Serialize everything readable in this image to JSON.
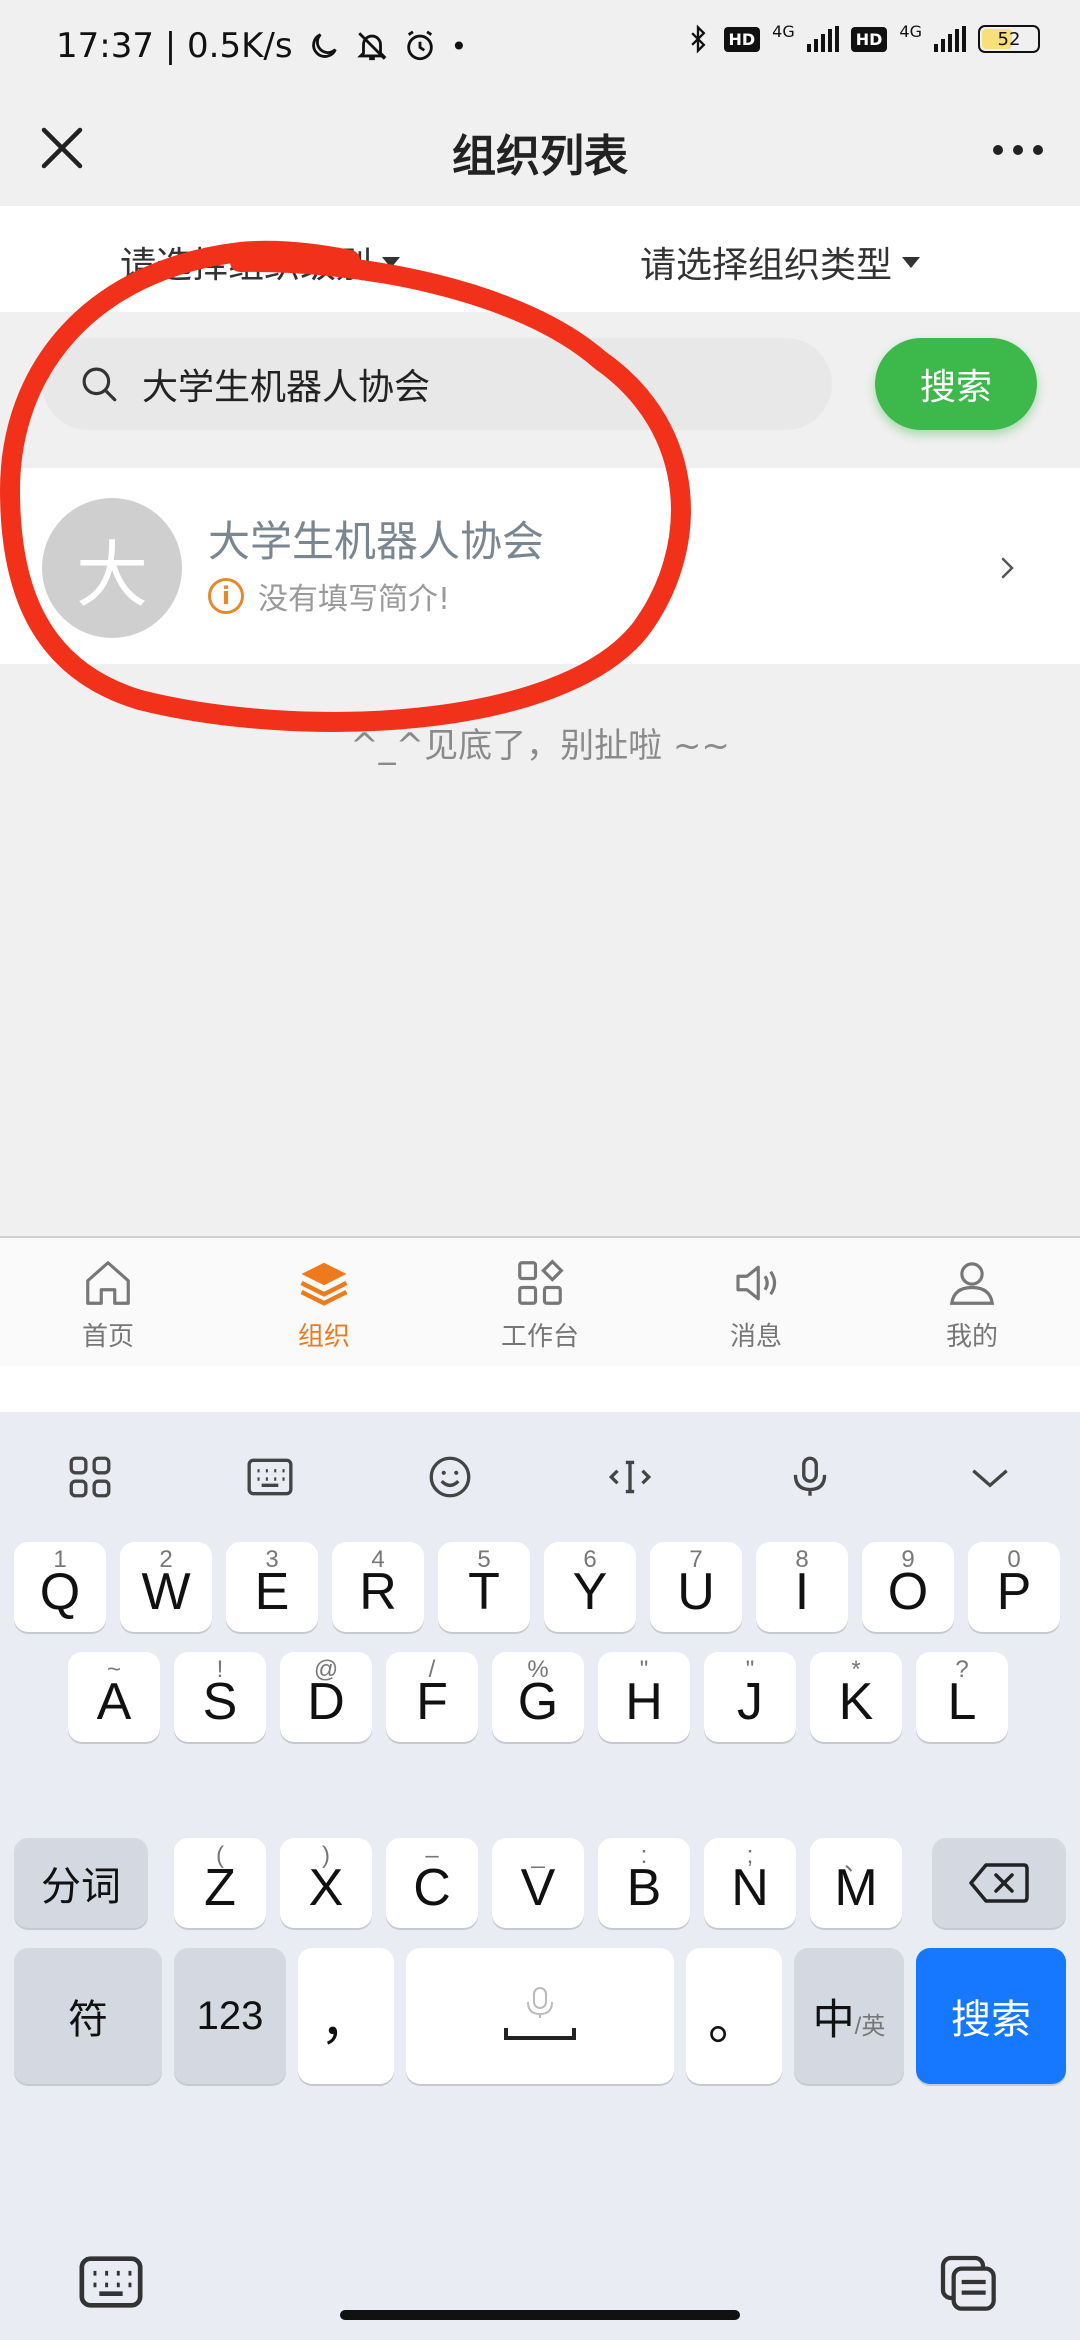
{
  "status_bar": {
    "time_speed": "17:37 | 0.5K/s",
    "net1": "4G",
    "net2": "4G",
    "hd": "HD",
    "battery": "52"
  },
  "navbar": {
    "title": "组织列表"
  },
  "filters": {
    "level_label": "请选择组织级别",
    "type_label": "请选择组织类型"
  },
  "search": {
    "value": "大学生机器人协会",
    "button_label": "搜索"
  },
  "results": [
    {
      "avatar_letter": "大",
      "name": "大学生机器人协会",
      "desc": "没有填写简介!"
    }
  ],
  "end_text": "^_^见底了，别扯啦 ~~",
  "tabbar": {
    "active_color": "#ee7a1c",
    "items": [
      {
        "label": "首页",
        "icon": "home-icon"
      },
      {
        "label": "组织",
        "icon": "layers-icon"
      },
      {
        "label": "工作台",
        "icon": "grid-icon"
      },
      {
        "label": "消息",
        "icon": "speaker-icon"
      },
      {
        "label": "我的",
        "icon": "user-icon"
      }
    ]
  },
  "keyboard": {
    "row1": [
      {
        "k": "Q",
        "s": "1"
      },
      {
        "k": "W",
        "s": "2"
      },
      {
        "k": "E",
        "s": "3"
      },
      {
        "k": "R",
        "s": "4"
      },
      {
        "k": "T",
        "s": "5"
      },
      {
        "k": "Y",
        "s": "6"
      },
      {
        "k": "U",
        "s": "7"
      },
      {
        "k": "I",
        "s": "8"
      },
      {
        "k": "O",
        "s": "9"
      },
      {
        "k": "P",
        "s": "0"
      }
    ],
    "row2": [
      {
        "k": "A",
        "s": "~"
      },
      {
        "k": "S",
        "s": "!"
      },
      {
        "k": "D",
        "s": "@"
      },
      {
        "k": "F",
        "s": "/"
      },
      {
        "k": "G",
        "s": "%"
      },
      {
        "k": "H",
        "s": "\""
      },
      {
        "k": "J",
        "s": "\""
      },
      {
        "k": "K",
        "s": "*"
      },
      {
        "k": "L",
        "s": "?"
      }
    ],
    "row3": [
      {
        "k": "Z",
        "s": "("
      },
      {
        "k": "X",
        "s": ")"
      },
      {
        "k": "C",
        "s": "–"
      },
      {
        "k": "V",
        "s": "_"
      },
      {
        "k": "B",
        "s": ":"
      },
      {
        "k": "N",
        "s": ";"
      },
      {
        "k": "M",
        "s": "、"
      }
    ],
    "fenci": "分词",
    "fu": "符",
    "num": "123",
    "comma": "，",
    "period": "。",
    "zh": "中",
    "zh_sub": "/英",
    "search_key": "搜索",
    "accent": "#1677ff"
  }
}
